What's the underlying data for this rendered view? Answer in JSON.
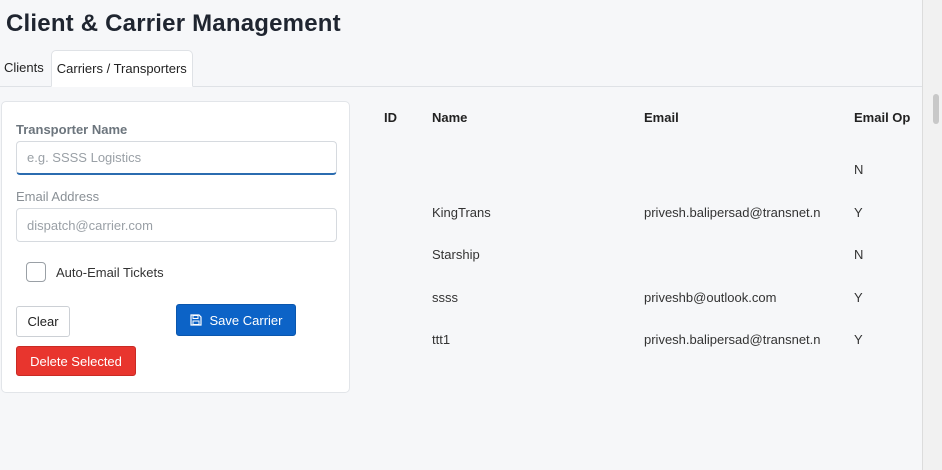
{
  "page": {
    "title": "Client & Carrier Management"
  },
  "tabs": [
    {
      "label": "Clients",
      "active": false
    },
    {
      "label": "Carriers / Transporters",
      "active": true
    }
  ],
  "form": {
    "name_label": "Transporter Name",
    "name_placeholder": "e.g. SSSS Logistics",
    "name_value": "",
    "email_label": "Email Address",
    "email_placeholder": "dispatch@carrier.com",
    "email_value": "",
    "auto_email_label": "Auto-Email Tickets",
    "auto_email_checked": false,
    "clear_label": "Clear",
    "save_label": "Save Carrier",
    "delete_label": "Delete Selected"
  },
  "grid": {
    "columns": [
      "ID",
      "Name",
      "Email",
      "Email Op"
    ],
    "rows": [
      {
        "id": "",
        "name": "",
        "email": "",
        "opt": "N"
      },
      {
        "id": "",
        "name": "KingTrans",
        "email": "privesh.balipersad@transnet.n",
        "opt": "Y"
      },
      {
        "id": "",
        "name": "Starship",
        "email": "",
        "opt": "N"
      },
      {
        "id": "",
        "name": "ssss",
        "email": "priveshb@outlook.com",
        "opt": "Y"
      },
      {
        "id": "",
        "name": "ttt1",
        "email": "privesh.balipersad@transnet.n",
        "opt": "Y"
      }
    ]
  },
  "colors": {
    "save_button": "#0c63c7",
    "delete_button": "#e8352e",
    "focus_border": "#2b6cb0"
  },
  "icons": {
    "save": "floppy-disk-icon"
  }
}
